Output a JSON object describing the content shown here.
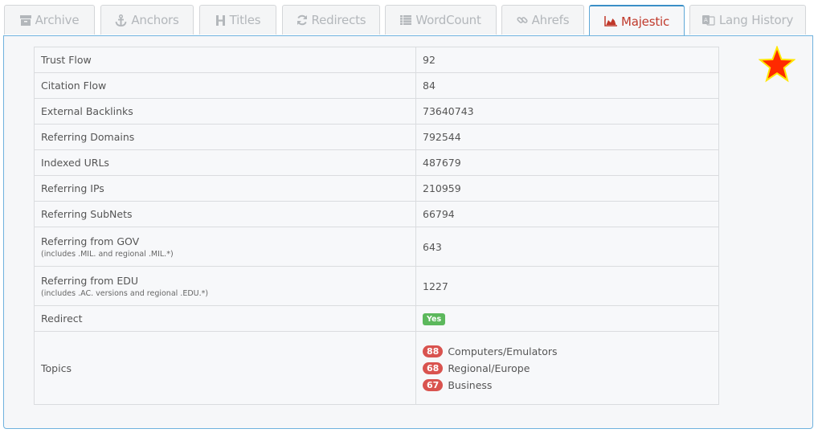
{
  "tabs": [
    {
      "label": "Archive",
      "icon": "archive-icon"
    },
    {
      "label": "Anchors",
      "icon": "anchor-icon"
    },
    {
      "label": "Titles",
      "icon": "heading-icon"
    },
    {
      "label": "Redirects",
      "icon": "refresh-icon"
    },
    {
      "label": "WordCount",
      "icon": "list-icon"
    },
    {
      "label": "Ahrefs",
      "icon": "link-icon"
    },
    {
      "label": "Majestic",
      "icon": "area-chart-icon",
      "active": true
    },
    {
      "label": "Lang History",
      "icon": "language-icon"
    }
  ],
  "colors": {
    "accent": "#c0392b",
    "active_border": "#3a8fc7",
    "yes_badge": "#5cb85c",
    "topic_badge": "#d9534f",
    "star": "#ff2a00"
  },
  "rows": {
    "trust_flow": {
      "label": "Trust Flow",
      "value": "92"
    },
    "citation_flow": {
      "label": "Citation Flow",
      "value": "84"
    },
    "external_backlinks": {
      "label": "External Backlinks",
      "value": "73640743"
    },
    "referring_domains": {
      "label": "Referring Domains",
      "value": "792544"
    },
    "indexed_urls": {
      "label": "Indexed URLs",
      "value": "487679"
    },
    "referring_ips": {
      "label": "Referring IPs",
      "value": "210959"
    },
    "referring_subnets": {
      "label": "Referring SubNets",
      "value": "66794"
    },
    "referring_gov": {
      "label": "Referring from GOV",
      "note": "(includes .MIL. and regional .MIL.*)",
      "value": "643"
    },
    "referring_edu": {
      "label": "Referring from EDU",
      "note": "(includes .AC. versions and regional .EDU.*)",
      "value": "1227"
    },
    "redirect": {
      "label": "Redirect",
      "value": "Yes"
    },
    "topics": {
      "label": "Topics",
      "items": [
        {
          "score": "88",
          "name": "Computers/Emulators"
        },
        {
          "score": "68",
          "name": "Regional/Europe"
        },
        {
          "score": "67",
          "name": "Business"
        }
      ]
    }
  }
}
